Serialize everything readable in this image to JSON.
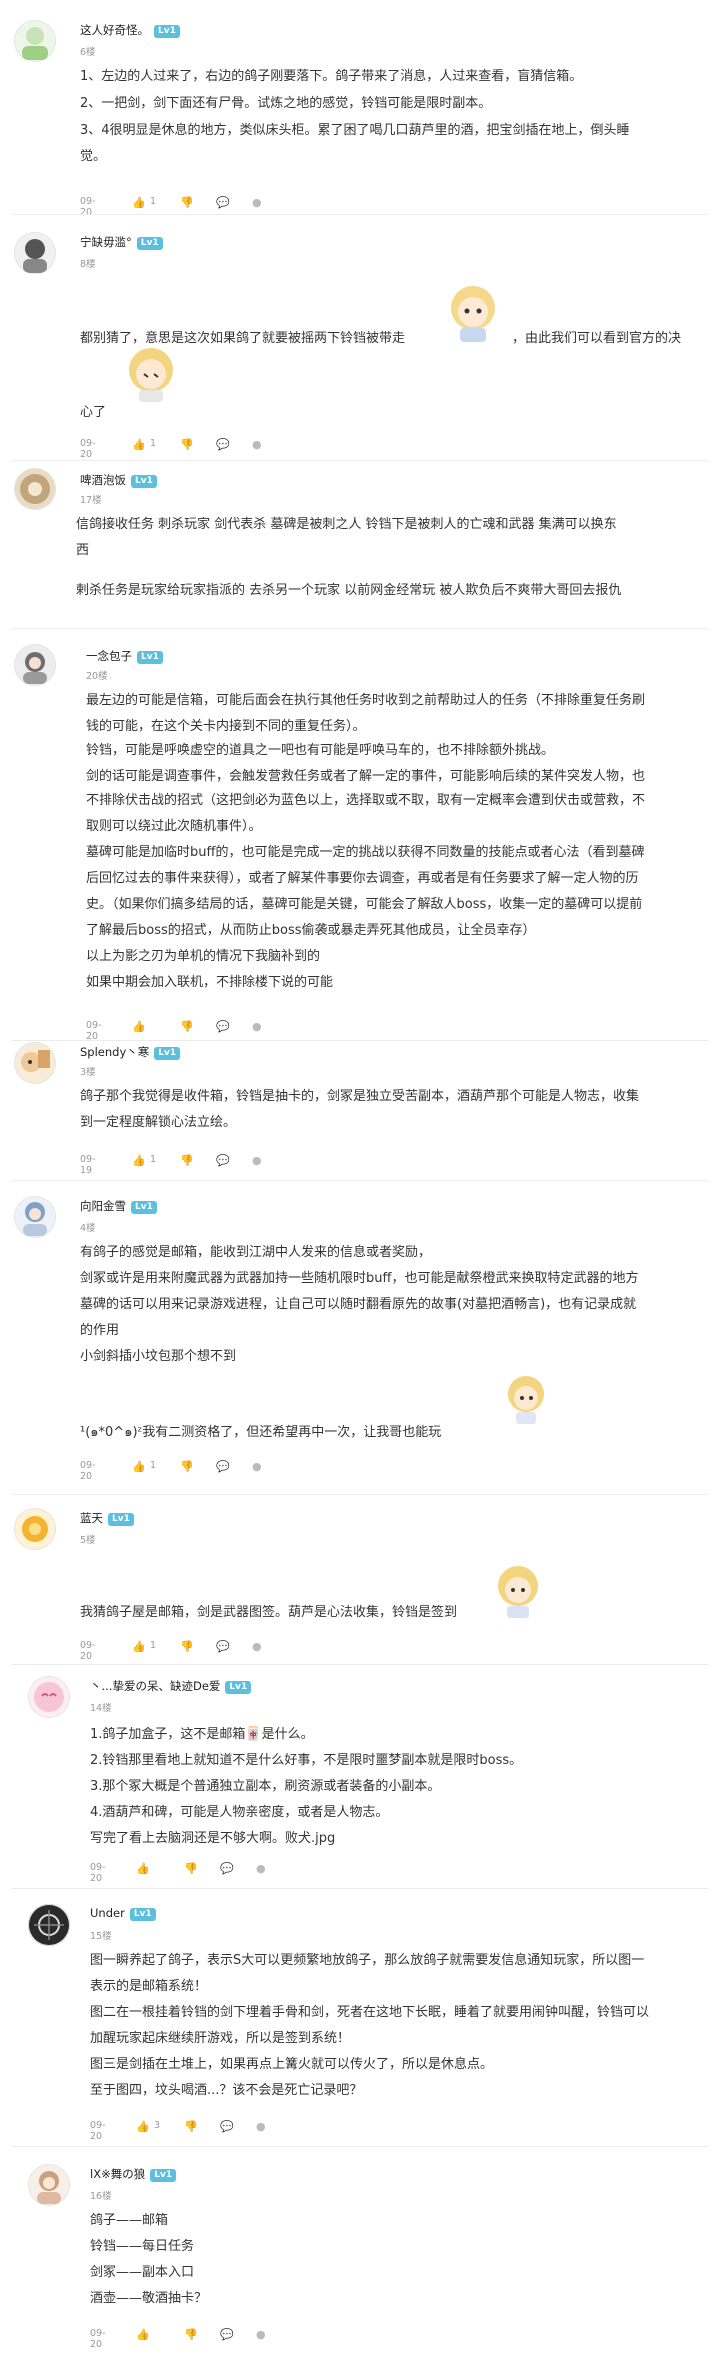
{
  "posts": [
    {
      "user": "这人好奇怪。",
      "level": "Lv1",
      "floor": "6楼",
      "lines": [
        "1、左边的人过来了，右边的鸽子刚要落下。鸽子带来了消息，人过来查看，盲猜信箱。",
        "2、一把剑，剑下面还有尸骨。试炼之地的感觉，铃铛可能是限时副本。",
        "3、4很明显是休息的地方，类似床头柜。累了困了喝几口葫芦里的酒，把宝剑插在地上，倒头睡",
        "觉。"
      ],
      "date": "09-20",
      "likes": "1"
    },
    {
      "user": "宁缺毋滥°",
      "level": "Lv1",
      "floor": "8楼",
      "lines": [
        "都别猜了，意思是这次如果鸽了就要被摇两下铃铛被带走",
        "，由此我们可以看到官方的决",
        "心了"
      ],
      "date": "09-20",
      "likes": "1"
    },
    {
      "user": "啤酒泡饭",
      "level": "Lv1",
      "floor": "17楼",
      "lines": [
        "信鸽接收任务 刺杀玩家   剑代表杀   墓碑是被刺之人   铃铛下是被刺人的亡魂和武器 集满可以换东",
        "西",
        "剌杀任务是玩家给玩家指派的   去杀另一个玩家 以前网金经常玩 被人欺负后不爽带大哥回去报仇"
      ],
      "date": "",
      "likes": ""
    },
    {
      "user": "一念包子",
      "level": "Lv1",
      "floor": "20楼",
      "lines": [
        "最左边的可能是信箱，可能后面会在执行其他任务时收到之前帮助过人的任务（不排除重复任务刷",
        "钱的可能，在这个关卡内接到不同的重复任务）。",
        "铃铛，可能是呼唤虚空的道具之一吧也有可能是呼唤马车的，也不排除额外挑战。",
        "剑的话可能是调查事件，会触发营救任务或者了解一定的事件，可能影响后续的某件突发人物，也",
        "不排除伏击战的招式（这把剑必为蓝色以上，选择取或不取，取有一定概率会遭到伏击或营救，不",
        "取则可以绕过此次随机事件）。",
        "墓碑可能是加临时buff的，也可能是完成一定的挑战以获得不同数量的技能点或者心法（看到墓碑",
        "后回忆过去的事件来获得），或者了解某件事要你去调查，再或者是有任务要求了解一定人物的历",
        "史。（如果你们搞多结局的话，墓碑可能是关键，可能会了解敌人boss，收集一定的墓碑可以提前",
        "了解最后boss的招式，从而防止boss偷袭或暴走弄死其他成员，让全员幸存）",
        "以上为影之刃为单机的情况下我脑补到的",
        "如果中期会加入联机，不排除楼下说的可能"
      ],
      "date": "09-20",
      "likes": ""
    },
    {
      "user": "Splendy丶寒",
      "level": "Lv1",
      "floor": "3楼",
      "lines": [
        "鸽子那个我觉得是收件箱，铃铛是抽卡的，剑冢是独立受苦副本，酒葫芦那个可能是人物志，收集",
        "到一定程度解锁心法立绘。"
      ],
      "date": "09-19",
      "likes": "1"
    },
    {
      "user": "向阳金雪",
      "level": "Lv1",
      "floor": "4楼",
      "lines": [
        "有鸽子的感觉是邮箱，能收到江湖中人发来的信息或者奖励，",
        "剑冢或许是用来附魔武器为武器加持一些随机限时buff，也可能是献祭橙武来换取特定武器的地方",
        "墓碑的话可以用来记录游戏进程，让自己可以随时翻看原先的故事(对墓把酒畅言)，也有记录成就",
        "的作用",
        "小剑斜插小坟包那个想不到",
        "¹(๑*0^๑)ᶻ我有二测资格了，但还希望再中一次，让我哥也能玩"
      ],
      "date": "09-20",
      "likes": "1"
    },
    {
      "user": "蓝天",
      "level": "Lv1",
      "floor": "5楼",
      "lines": [
        "我猜鸽子屋是邮箱，剑是武器图签。葫芦是心法收集，铃铛是签到"
      ],
      "date": "09-20",
      "likes": "1"
    },
    {
      "user": "丶...挚爱の呆、缺迹De爱",
      "level": "Lv1",
      "floor": "14楼",
      "lines": [
        "1.鸽子加盒子，这不是邮箱🀄是什么。",
        "2.铃铛那里看地上就知道不是什么好事，不是限时噩梦副本就是限时boss。",
        "3.那个冢大概是个普通独立副本，刷资源或者装备的小副本。",
        "4.酒葫芦和碑，可能是人物亲密度，或者是人物志。",
        "写完了看上去脑洞还是不够大啊。败犬.jpg"
      ],
      "date": "09-20",
      "likes": ""
    },
    {
      "user": "Under",
      "level": "Lv1",
      "floor": "15楼",
      "lines": [
        "图一瞬养起了鸽子，表示S大可以更频繁地放鸽子，那么放鸽子就需要发信息通知玩家，所以图一",
        "表示的是邮箱系统！",
        "图二在一根挂着铃铛的剑下埋着手骨和剑，死者在这地下长眠，睡着了就要用闹钟叫醒，铃铛可以",
        "加醒玩家起床继续肝游戏，所以是签到系统！",
        "图三是剑插在土堆上，如果再点上篝火就可以传火了，所以是休息点。",
        "至于图四，坟头喝酒...？该不会是死亡记录吧？"
      ],
      "date": "09-20",
      "likes": "3"
    },
    {
      "user": "lX※舞の狼",
      "level": "Lv1",
      "floor": "16楼",
      "lines": [
        "鸽子——邮箱",
        "铃铛——每日任务",
        "剑冢——副本入口",
        "酒壶——敬酒抽卡？"
      ],
      "date": "09-20",
      "likes": ""
    }
  ],
  "icons": {
    "like": "thumbs-up-icon",
    "dislike": "thumbs-down-icon",
    "comment": "comment-icon",
    "share": "share-icon",
    "more": "more-icon"
  }
}
